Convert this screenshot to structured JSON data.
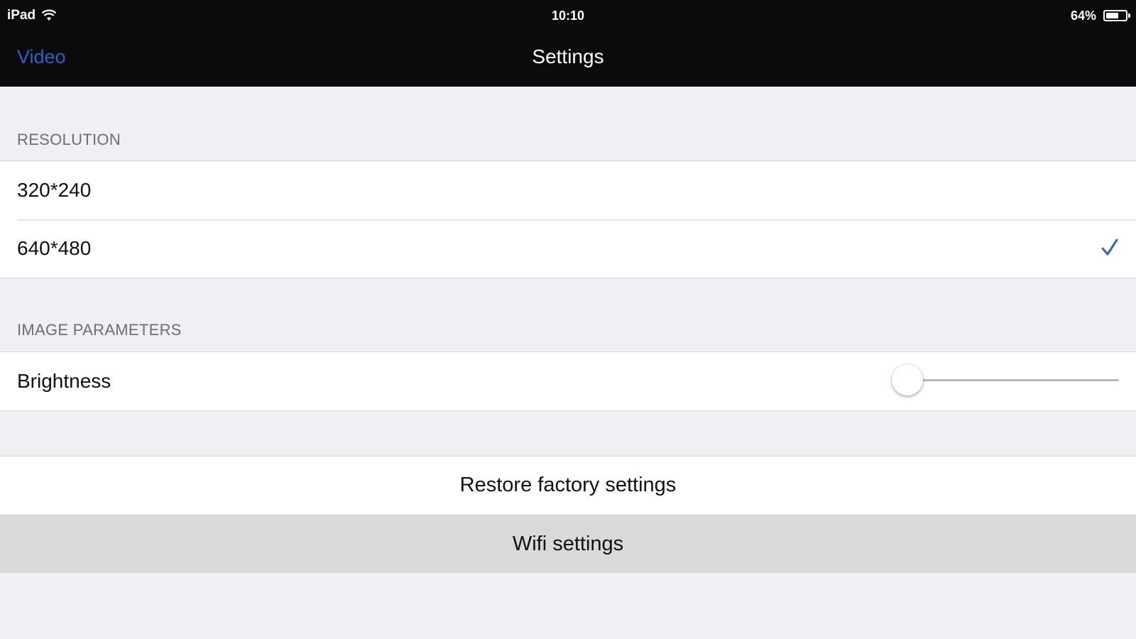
{
  "status_bar": {
    "device": "iPad",
    "time": "10:10",
    "battery": "64%",
    "battery_level": 0.64,
    "icons": [
      "wifi-icon",
      "battery-icon"
    ]
  },
  "nav": {
    "back_label": "Video",
    "title": "Settings",
    "back_color": "#2b63c9"
  },
  "resolution": {
    "header": "RESOLUTION",
    "options": [
      {
        "label": "320*240",
        "selected": false
      },
      {
        "label": "640*480",
        "selected": true
      }
    ],
    "checkmark_color": "#2b63c9"
  },
  "image_parameters": {
    "header": "IMAGE PARAMETERS",
    "brightness": {
      "label": "Brightness",
      "value": 0
    }
  },
  "actions": {
    "restore_label": "Restore factory settings",
    "wifi_label": "Wifi settings",
    "wifi_highlighted": true
  },
  "colors": {
    "background": "#efeff4",
    "bar": "#0b0b0b",
    "cell": "#ffffff",
    "highlight": "#d9d9d9"
  }
}
